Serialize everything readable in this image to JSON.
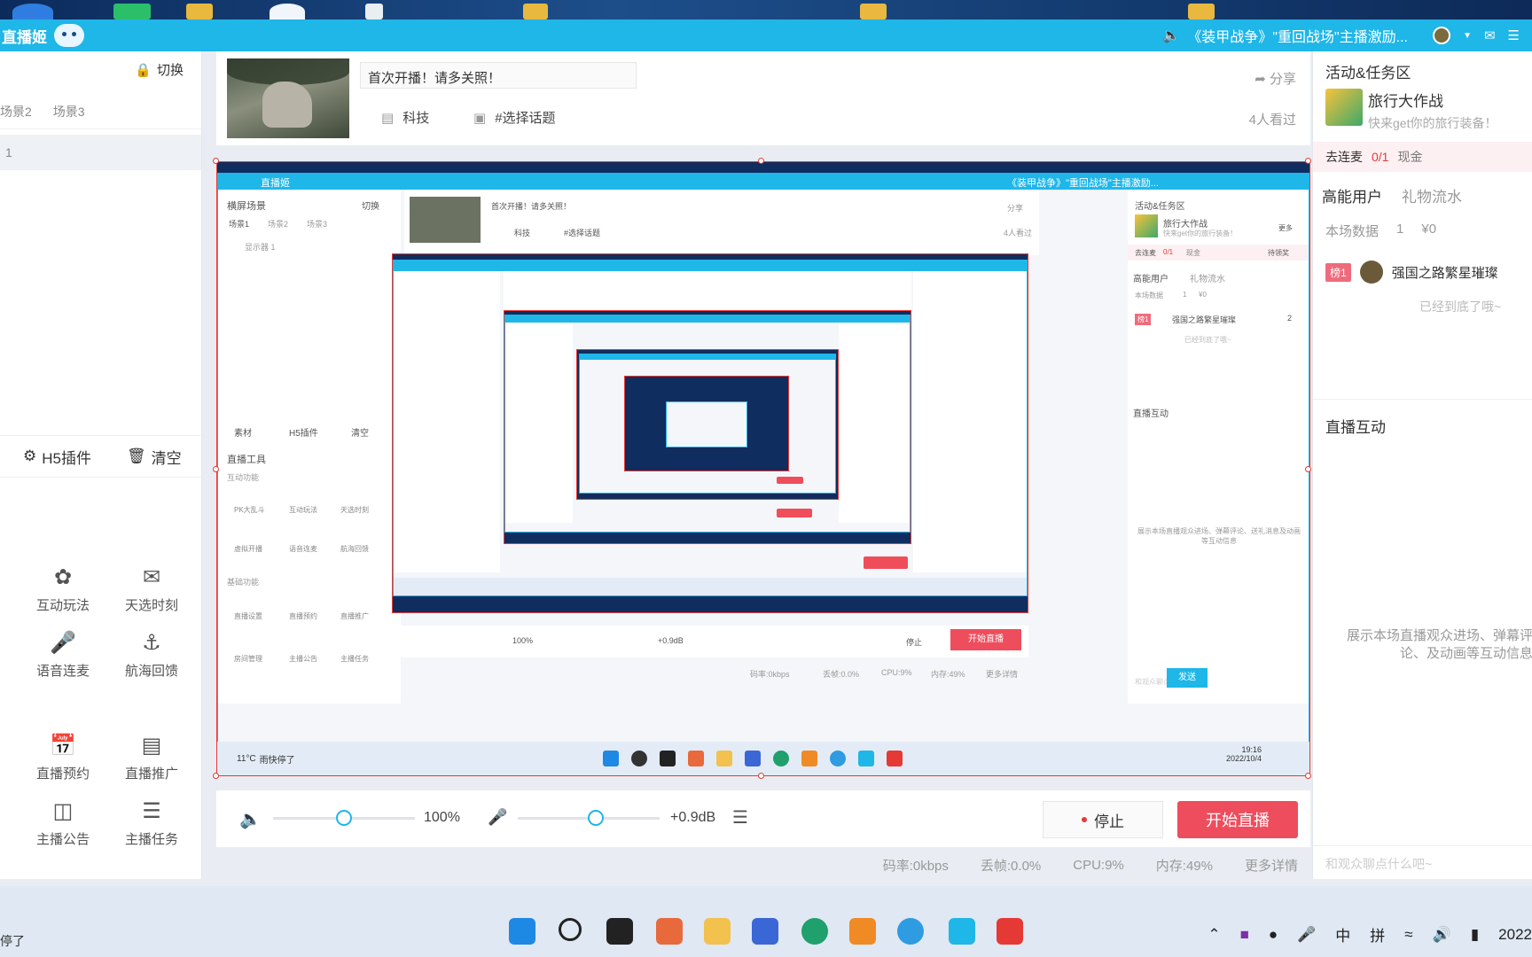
{
  "app": {
    "name": "直播姬",
    "notice": "《装甲战争》\"重回战场\"主播激励..."
  },
  "left": {
    "switch_label": "切换",
    "scenes": [
      "场景2",
      "场景3"
    ],
    "display_row": "1",
    "h5_plugin": "H5插件",
    "clear": "清空",
    "tools": [
      {
        "label": "互动玩法",
        "icon": "palette-icon"
      },
      {
        "label": "天选时刻",
        "icon": "gift-box-icon"
      },
      {
        "label": "语音连麦",
        "icon": "mic-link-icon"
      },
      {
        "label": "航海回馈",
        "icon": "anchor-icon"
      },
      {
        "label": "直播预约",
        "icon": "calendar-icon"
      },
      {
        "label": "直播推广",
        "icon": "promotion-icon"
      },
      {
        "label": "主播公告",
        "icon": "announcement-icon"
      },
      {
        "label": "主播任务",
        "icon": "task-icon"
      }
    ]
  },
  "info": {
    "title_value": "首次开播！请多关照！",
    "category": "科技",
    "topic": "#选择话题",
    "share": "分享",
    "viewers": "4人看过"
  },
  "preview": {
    "nested": {
      "title": "直播姬",
      "notice": "《装甲战争》\"重回战场\"主播激励...",
      "header_left": "横屏场景",
      "switch": "切换",
      "scenes": [
        "场景1",
        "场景2",
        "场景3"
      ],
      "display": "显示器 1",
      "assets": "素材",
      "h5": "H5插件",
      "clear": "清空",
      "live_tools": "直播工具",
      "interactive": "互动功能",
      "basic": "基础功能",
      "tools_row1": [
        "PK大乱斗",
        "互动玩法",
        "天选时刻"
      ],
      "tools_row2": [
        "虚拟开播",
        "语音连麦",
        "航海回馈"
      ],
      "tools_row3": [
        "直播设置",
        "直播预约",
        "直播推广"
      ],
      "tools_row4": [
        "房间管理",
        "主播公告",
        "主播任务"
      ],
      "title_value": "首次开播！请多关照！",
      "category": "科技",
      "topic": "#选择话题",
      "share": "分享",
      "viewers": "4人看过",
      "activity": "活动&任务区",
      "act_title": "旅行大作战",
      "act_sub": "快来get你的旅行装备！",
      "more": "更多",
      "lianmai": "去连麦",
      "lianmai_count": "0/1",
      "cash": "现金",
      "pending": "待领奖",
      "hp_users": "高能用户",
      "gift_flow": "礼物流水",
      "data_label": "本场数据",
      "data_count": "1",
      "data_money": "¥0",
      "rank": "榜1",
      "username": "强国之路繁星璀璨",
      "user_val": "2",
      "end_text": "已经到底了哦~",
      "hudong": "直播互动",
      "hudong_desc": "展示本场直播观众进场、弹幕评论、送礼消息及动画等互动信息",
      "volume": "100%",
      "gain": "+0.9dB",
      "stop": "停止",
      "start": "开始直播",
      "bitrate": "码率:0kbps",
      "drop": "丢帧:0.0%",
      "cpu": "CPU:9%",
      "mem": "内存:49%",
      "details": "更多详情",
      "input_ph": "和观众聊点什么吧~",
      "send": "发送",
      "weather_temp": "11°C",
      "weather_desc": "雨快停了",
      "time": "19:16",
      "date": "2022/10/4"
    }
  },
  "audio": {
    "volume": "100%",
    "gain": "+0.9dB",
    "volume_level": 0.5,
    "mic_level": 0.55
  },
  "controls": {
    "stop": "停止",
    "start": "开始直播"
  },
  "stats": {
    "bitrate": "码率:0kbps",
    "drop": "丢帧:0.0%",
    "cpu": "CPU:9%",
    "mem": "内存:49%",
    "details": "更多详情"
  },
  "right": {
    "activity_title": "活动&任务区",
    "act_title": "旅行大作战",
    "act_sub": "快来get你的旅行装备！",
    "lianmai": "去连麦",
    "lianmai_count": "0/1",
    "cash": "现金",
    "hp_users": "高能用户",
    "gift_flow": "礼物流水",
    "data_label": "本场数据",
    "data_count": "1",
    "data_money": "¥0",
    "rank": "榜1",
    "username": "强国之路繁星璀璨",
    "end_text": "已经到底了哦~",
    "hudong": "直播互动",
    "hudong_desc": "展示本场直播观众进场、弹幕评论、及动画等互动信息",
    "input_ph": "和观众聊点什么吧~"
  },
  "taskbar": {
    "status": "停了",
    "ime_zh": "中",
    "ime_pin": "拼",
    "year": "2022",
    "apps": [
      "start-icon",
      "search-icon",
      "taskview-icon",
      "snip-icon",
      "folder-icon",
      "baidu-icon",
      "edge-icon",
      "compass-icon",
      "browser-icon",
      "livestream-app-icon",
      "wps-icon"
    ]
  },
  "colors": {
    "accent": "#1fb6e8",
    "start_red": "#ee4d5d",
    "border_red": "#e53935"
  }
}
